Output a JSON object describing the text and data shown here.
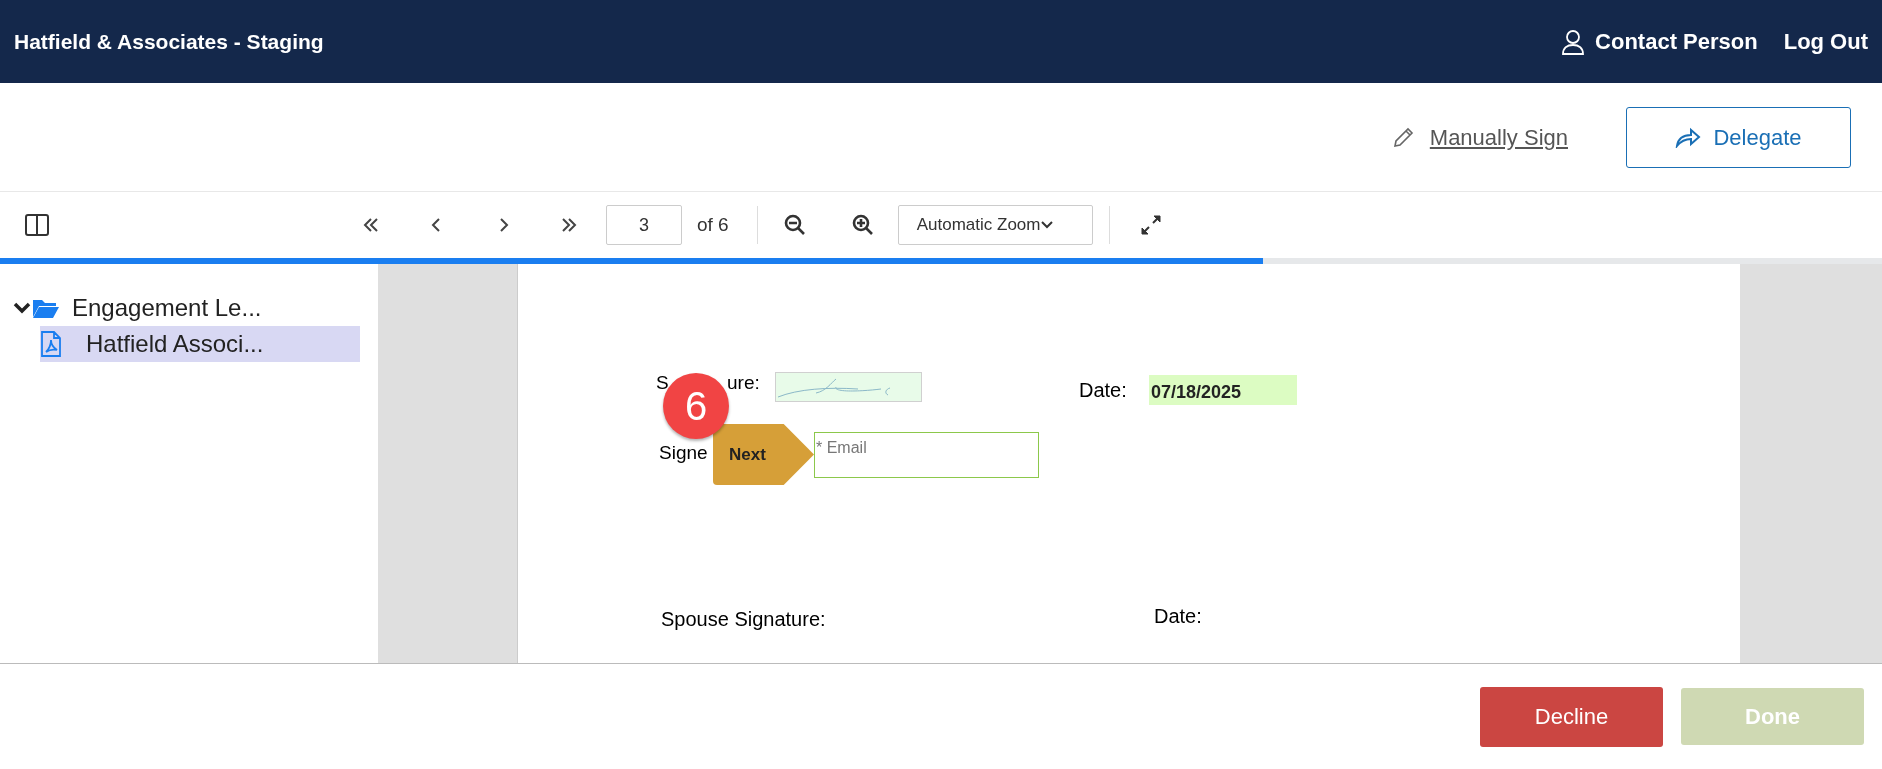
{
  "header": {
    "title": "Hatfield & Associates - Staging",
    "user": "Contact Person",
    "logout": "Log Out"
  },
  "actions": {
    "manual_sign": "Manually Sign",
    "delegate": "Delegate"
  },
  "toolbar": {
    "page": "3",
    "page_total": "of 6",
    "zoom": "Automatic Zoom"
  },
  "progress": {
    "level": 0.671
  },
  "tree": [
    {
      "label": "Engagement Le...",
      "kind": "folder",
      "expanded": true,
      "selected": false,
      "children": [
        {
          "label": "Hatfield Associ...",
          "kind": "pdf",
          "selected": true
        }
      ]
    }
  ],
  "document": {
    "signature_label_start": "S",
    "signature_label_end": "ure:",
    "date_label": "Date:",
    "date_value": "07/18/2025",
    "signer_label": "Signe",
    "step_badge": "6",
    "next_tag": "Next",
    "email_placeholder": "* Email",
    "spouse_signature_label": "Spouse Signature:",
    "spouse_date_label": "Date:"
  },
  "footer": {
    "decline": "Decline",
    "done": "Done",
    "done_disabled": true
  }
}
